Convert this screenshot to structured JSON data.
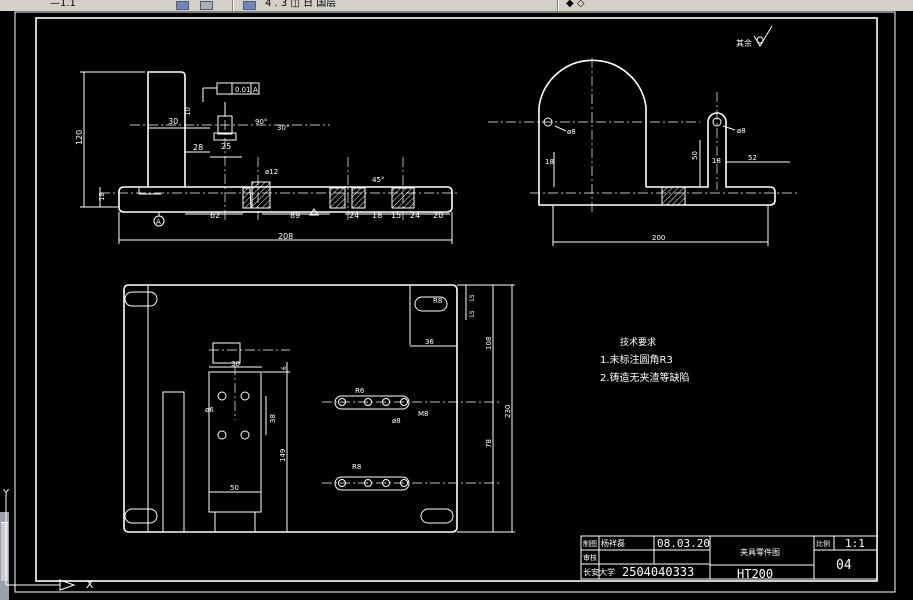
{
  "toolbar": {
    "left_text": "—1.1",
    "right_text": "4 . 3 ◫ 日 国层",
    "right_text2": "◆ ◇"
  },
  "drawing": {
    "surface_finish": "其余",
    "tolerance_frame": {
      "value": "0.01",
      "datum": "A"
    },
    "datum_label": "A",
    "front_view_dims": {
      "height_120": "120",
      "dim_30": "30",
      "dim_28": "28",
      "dim_25": "25",
      "dim_10": "10",
      "dim_18": "18",
      "dim_phi12": "ø12",
      "dim_62": "62",
      "dim_89": "89",
      "dim_24a": "24",
      "dim_18b": "18",
      "dim_15": "15",
      "dim_24b": "24",
      "dim_20": "20",
      "dim_208": "208",
      "angle_90": "90°",
      "angle_30": "30°",
      "angle_45": "45°"
    },
    "side_view_dims": {
      "phi8_left": "ø8",
      "phi8_right": "ø8",
      "dim_18": "18",
      "dim_50": "50",
      "dim_18b": "18",
      "dim_52": "52",
      "dim_200": "200"
    },
    "top_view_dims": {
      "R8": "R8",
      "dim_15": "15",
      "dim_15b": "15",
      "dim_36": "36",
      "dim_108": "108",
      "dim_230": "230",
      "dim_78": "78",
      "dim_30": "30",
      "dim_6": "6",
      "phi6": "ø6",
      "dim_38": "38",
      "dim_149": "149",
      "dim_50": "50",
      "R6": "R6",
      "phi8": "ø8",
      "M8": "M8",
      "R8b": "R8"
    },
    "tech_requirements": {
      "title": "技术要求",
      "line1": "1.未标注圆角R3",
      "line2": "2.铸造无夹渣等缺陷"
    }
  },
  "title_block": {
    "row1_label": "制图",
    "row1_name": "杨祥磊",
    "row1_date": "08.03.20",
    "row2_label": "审核",
    "part_name": "夹具零件图",
    "school": "长安大学",
    "student_id": "2504040333",
    "material": "HT200",
    "scale_label": "比例",
    "scale": "1:1",
    "drawing_no": "04"
  },
  "ucs": {
    "y_label": "Y",
    "x_label": "X"
  },
  "colors": {
    "background": "#000000",
    "lines": "#ffffff",
    "toolbar": "#d4d0c8"
  }
}
